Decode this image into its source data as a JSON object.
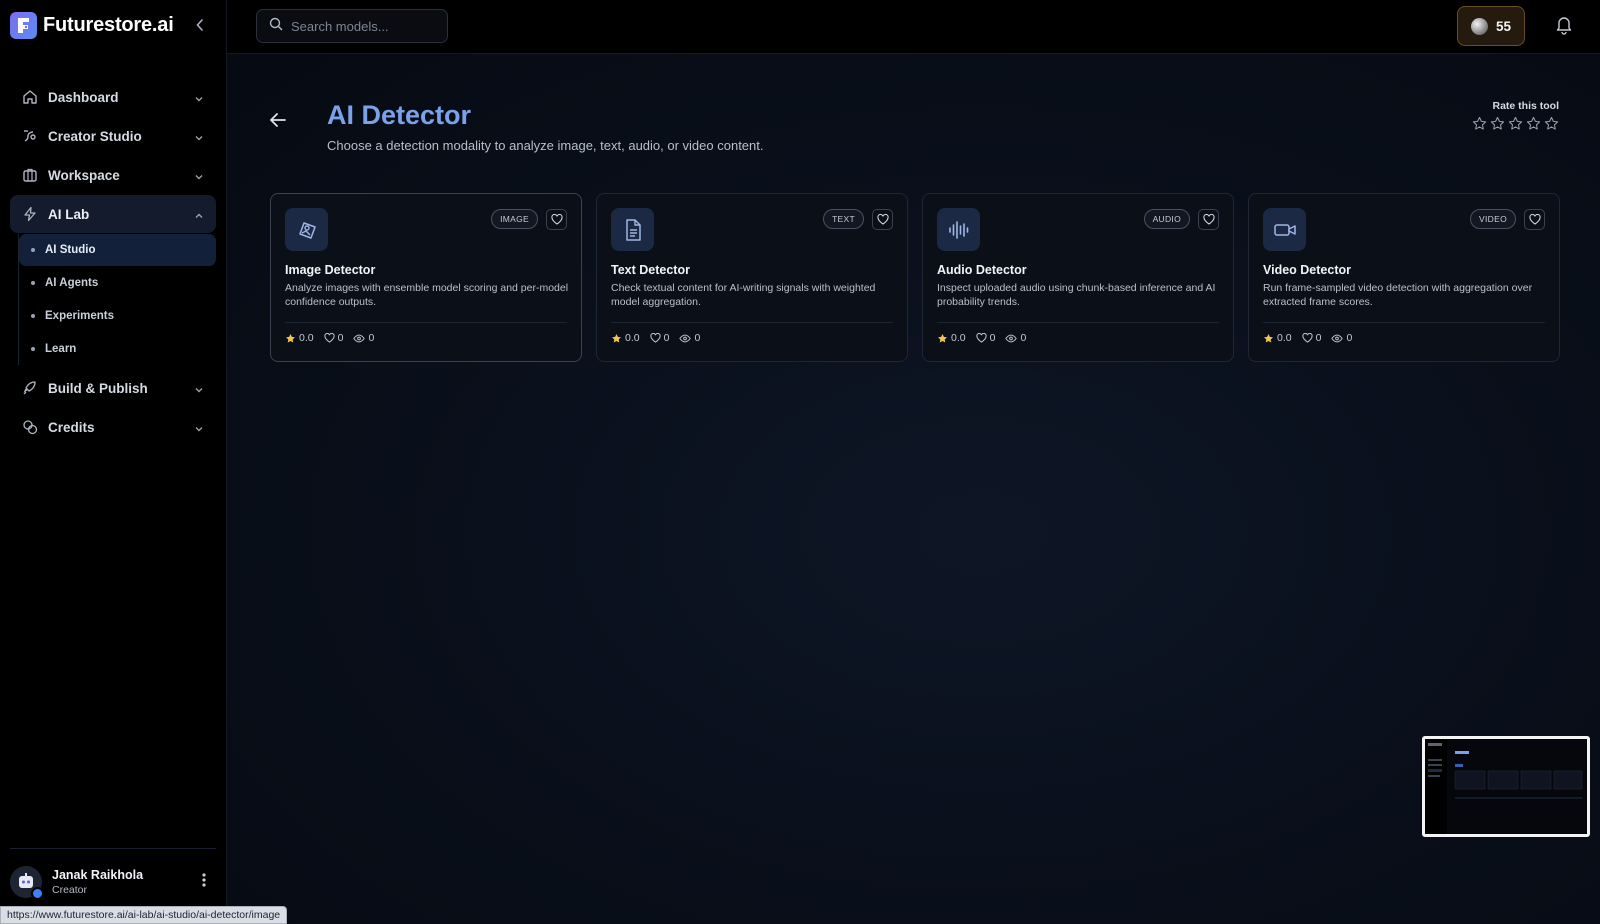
{
  "brand": {
    "name": "Futurestore.ai"
  },
  "search": {
    "placeholder": "Search models..."
  },
  "topbar": {
    "credits": "55"
  },
  "sidebar": {
    "items": [
      {
        "label": "Dashboard"
      },
      {
        "label": "Creator Studio"
      },
      {
        "label": "Workspace"
      },
      {
        "label": "AI Lab"
      },
      {
        "label": "Build & Publish"
      },
      {
        "label": "Credits"
      }
    ],
    "ai_lab_sub": [
      {
        "label": "AI Studio"
      },
      {
        "label": "AI Agents"
      },
      {
        "label": "Experiments"
      },
      {
        "label": "Learn"
      }
    ]
  },
  "user": {
    "name": "Janak Raikhola",
    "role": "Creator"
  },
  "status_url": "https://www.futurestore.ai/ai-lab/ai-studio/ai-detector/image",
  "page": {
    "title": "AI Detector",
    "subtitle": "Choose a detection modality to analyze image, text, audio, or video content.",
    "rate_label": "Rate this tool",
    "rating": 0
  },
  "cards": [
    {
      "tag": "IMAGE",
      "title": "Image Detector",
      "desc": "Analyze images with ensemble model scoring and per-model confidence outputs.",
      "rating": "0.0",
      "likes": "0",
      "views": "0",
      "icon": "image-detector-icon"
    },
    {
      "tag": "TEXT",
      "title": "Text Detector",
      "desc": "Check textual content for AI-writing signals with weighted model aggregation.",
      "rating": "0.0",
      "likes": "0",
      "views": "0",
      "icon": "document-icon"
    },
    {
      "tag": "AUDIO",
      "title": "Audio Detector",
      "desc": "Inspect uploaded audio using chunk-based inference and AI probability trends.",
      "rating": "0.0",
      "likes": "0",
      "views": "0",
      "icon": "audio-wave-icon"
    },
    {
      "tag": "VIDEO",
      "title": "Video Detector",
      "desc": "Run frame-sampled video detection with aggregation over extracted frame scores.",
      "rating": "0.0",
      "likes": "0",
      "views": "0",
      "icon": "video-camera-icon"
    }
  ],
  "colors": {
    "accent": "#7aa2e8",
    "active_nav": "#131b2c",
    "credit_border": "#6b4e22",
    "star": "#f5c44f"
  }
}
